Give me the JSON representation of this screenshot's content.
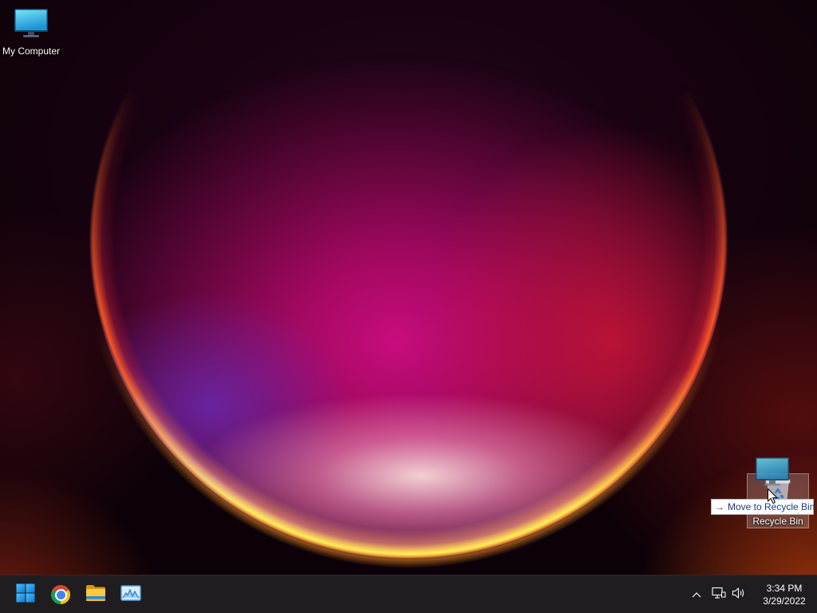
{
  "desktop": {
    "icons": [
      {
        "label": "My Computer",
        "icon": "computer-icon",
        "selected": false
      },
      {
        "label": "Recycle Bin",
        "icon": "recycle-bin-icon",
        "selected": true
      }
    ]
  },
  "drag": {
    "dragged_icon": "computer-icon",
    "tooltip": {
      "arrow": "→",
      "text": "Move to Recycle Bin"
    }
  },
  "taskbar": {
    "pinned": [
      {
        "icon": "windows-start-icon"
      },
      {
        "icon": "chrome-icon"
      },
      {
        "icon": "file-explorer-icon"
      },
      {
        "icon": "photos-icon"
      }
    ],
    "tray_icons": [
      "chevron-up-icon",
      "network-icon",
      "volume-icon"
    ],
    "clock": {
      "time": "3:34 PM",
      "date": "3/29/2022"
    }
  },
  "colors": {
    "taskbar_bg": "#1f1d20",
    "accent": "#0078d4",
    "tooltip_bg": "#ffffff",
    "tooltip_text": "#1b3a8c",
    "selection_bg": "rgba(255,255,255,0.2)"
  }
}
